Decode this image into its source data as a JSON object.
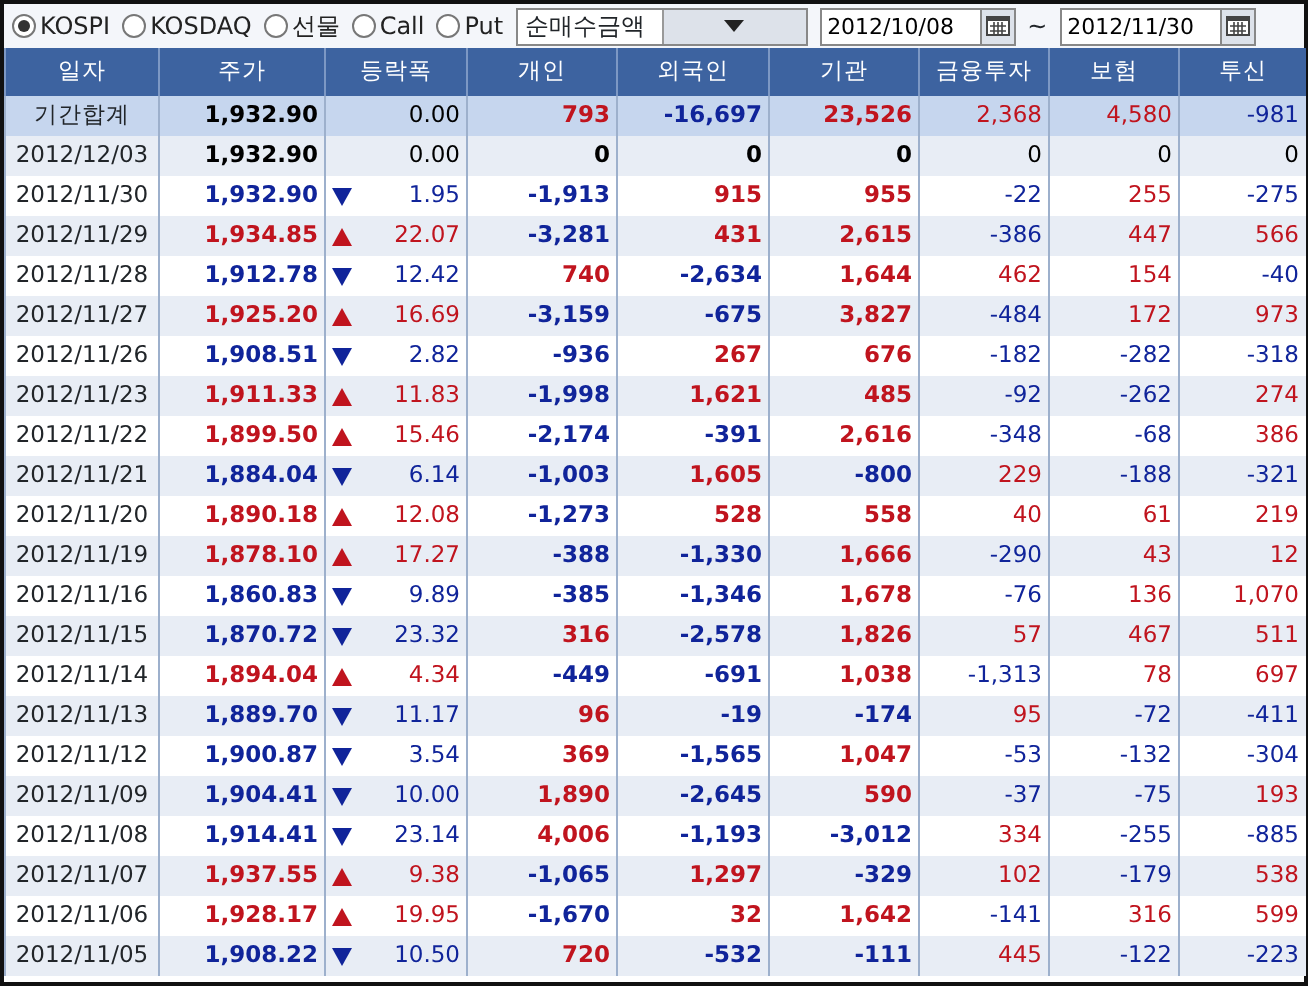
{
  "market_options": [
    {
      "label": "KOSPI",
      "selected": true
    },
    {
      "label": "KOSDAQ",
      "selected": false
    },
    {
      "label": "선물",
      "selected": false
    },
    {
      "label": "Call",
      "selected": false
    },
    {
      "label": "Put",
      "selected": false
    }
  ],
  "amount_type": {
    "value": "순매수금액"
  },
  "date_from": {
    "value": "2012/10/08"
  },
  "range_separator": "~",
  "date_to": {
    "value": "2012/11/30"
  },
  "table": {
    "columns": [
      "일자",
      "주가",
      "등락폭",
      "개인",
      "외국인",
      "기관",
      "금융투자",
      "보험",
      "투신"
    ],
    "rows": [
      {
        "kind": "total",
        "cells": [
          "기간합계",
          "1,932.90",
          "0.00",
          "793",
          "-16,697",
          "23,526",
          "2,368",
          "4,580",
          "-981"
        ]
      },
      {
        "kind": "flat",
        "cells": [
          "2012/12/03",
          "1,932.90",
          "0.00",
          "0",
          "0",
          "0",
          "0",
          "0",
          "0"
        ]
      },
      {
        "kind": "falling",
        "cells": [
          "2012/11/30",
          "1,932.90",
          "1.95",
          "-1,913",
          "915",
          "955",
          "-22",
          "255",
          "-275"
        ]
      },
      {
        "kind": "rising",
        "cells": [
          "2012/11/29",
          "1,934.85",
          "22.07",
          "-3,281",
          "431",
          "2,615",
          "-386",
          "447",
          "566"
        ]
      },
      {
        "kind": "falling",
        "cells": [
          "2012/11/28",
          "1,912.78",
          "12.42",
          "740",
          "-2,634",
          "1,644",
          "462",
          "154",
          "-40"
        ]
      },
      {
        "kind": "rising",
        "cells": [
          "2012/11/27",
          "1,925.20",
          "16.69",
          "-3,159",
          "-675",
          "3,827",
          "-484",
          "172",
          "973"
        ]
      },
      {
        "kind": "falling",
        "cells": [
          "2012/11/26",
          "1,908.51",
          "2.82",
          "-936",
          "267",
          "676",
          "-182",
          "-282",
          "-318"
        ]
      },
      {
        "kind": "rising",
        "cells": [
          "2012/11/23",
          "1,911.33",
          "11.83",
          "-1,998",
          "1,621",
          "485",
          "-92",
          "-262",
          "274"
        ]
      },
      {
        "kind": "rising",
        "cells": [
          "2012/11/22",
          "1,899.50",
          "15.46",
          "-2,174",
          "-391",
          "2,616",
          "-348",
          "-68",
          "386"
        ]
      },
      {
        "kind": "falling",
        "cells": [
          "2012/11/21",
          "1,884.04",
          "6.14",
          "-1,003",
          "1,605",
          "-800",
          "229",
          "-188",
          "-321"
        ]
      },
      {
        "kind": "rising",
        "cells": [
          "2012/11/20",
          "1,890.18",
          "12.08",
          "-1,273",
          "528",
          "558",
          "40",
          "61",
          "219"
        ]
      },
      {
        "kind": "rising",
        "cells": [
          "2012/11/19",
          "1,878.10",
          "17.27",
          "-388",
          "-1,330",
          "1,666",
          "-290",
          "43",
          "12"
        ]
      },
      {
        "kind": "falling",
        "cells": [
          "2012/11/16",
          "1,860.83",
          "9.89",
          "-385",
          "-1,346",
          "1,678",
          "-76",
          "136",
          "1,070"
        ]
      },
      {
        "kind": "falling",
        "cells": [
          "2012/11/15",
          "1,870.72",
          "23.32",
          "316",
          "-2,578",
          "1,826",
          "57",
          "467",
          "511"
        ]
      },
      {
        "kind": "rising",
        "cells": [
          "2012/11/14",
          "1,894.04",
          "4.34",
          "-449",
          "-691",
          "1,038",
          "-1,313",
          "78",
          "697"
        ]
      },
      {
        "kind": "falling",
        "cells": [
          "2012/11/13",
          "1,889.70",
          "11.17",
          "96",
          "-19",
          "-174",
          "95",
          "-72",
          "-411"
        ]
      },
      {
        "kind": "falling",
        "cells": [
          "2012/11/12",
          "1,900.87",
          "3.54",
          "369",
          "-1,565",
          "1,047",
          "-53",
          "-132",
          "-304"
        ]
      },
      {
        "kind": "falling",
        "cells": [
          "2012/11/09",
          "1,904.41",
          "10.00",
          "1,890",
          "-2,645",
          "590",
          "-37",
          "-75",
          "193"
        ]
      },
      {
        "kind": "falling",
        "cells": [
          "2012/11/08",
          "1,914.41",
          "23.14",
          "4,006",
          "-1,193",
          "-3,012",
          "334",
          "-255",
          "-885"
        ]
      },
      {
        "kind": "rising",
        "cells": [
          "2012/11/07",
          "1,937.55",
          "9.38",
          "-1,065",
          "1,297",
          "-329",
          "102",
          "-179",
          "538"
        ]
      },
      {
        "kind": "rising",
        "cells": [
          "2012/11/06",
          "1,928.17",
          "19.95",
          "-1,670",
          "32",
          "1,642",
          "-141",
          "316",
          "599"
        ]
      },
      {
        "kind": "falling",
        "cells": [
          "2012/11/05",
          "1,908.22",
          "10.50",
          "720",
          "-532",
          "-111",
          "445",
          "-122",
          "-223"
        ]
      }
    ]
  }
}
